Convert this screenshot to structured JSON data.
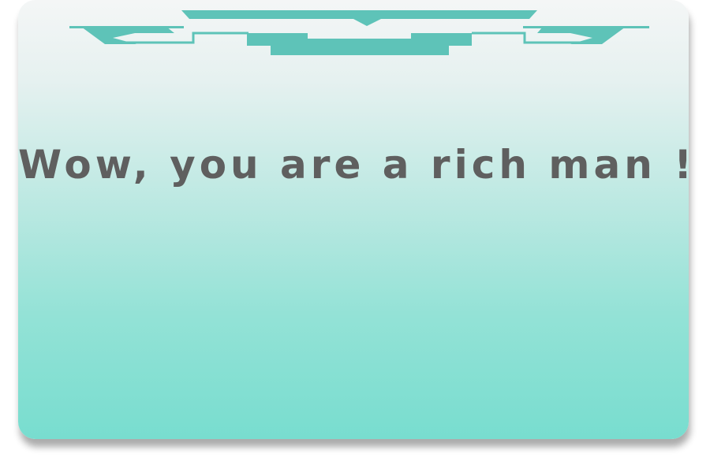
{
  "dialog": {
    "message": "Wow, you are a rich man !"
  },
  "ornament": {
    "name": "header-ornament",
    "color": "#5ec3b8"
  },
  "colors": {
    "text": "#5f5f5f",
    "gradient_top": "#f4f6f6",
    "gradient_bottom": "#78ddcf"
  }
}
